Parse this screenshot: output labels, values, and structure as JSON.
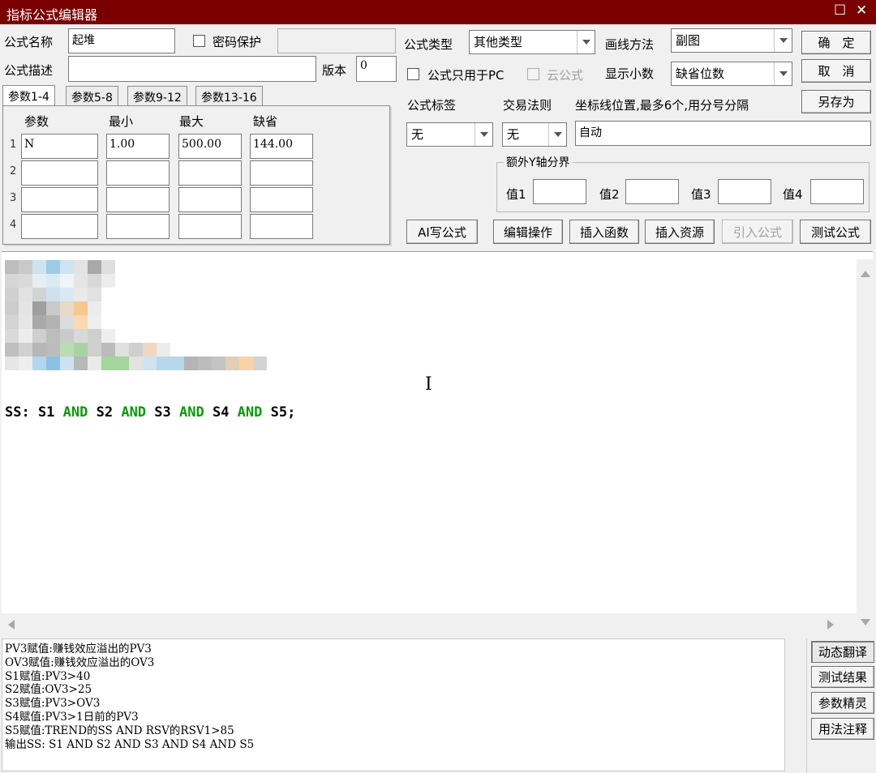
{
  "window": {
    "title": "指标公式编辑器",
    "maximize_glyph": "☐",
    "close_glyph": "✕"
  },
  "form": {
    "name_label": "公式名称",
    "name_value": "起堆",
    "password_label": "密码保护",
    "password_value": "",
    "desc_label": "公式描述",
    "desc_value": "",
    "version_label": "版本",
    "version_value": "0",
    "type_label": "公式类型",
    "type_value": "其他类型",
    "draw_label": "画线方法",
    "draw_value": "副图",
    "pc_only_label": "公式只用于PC",
    "cloud_label": "云公式",
    "decimal_label": "显示小数",
    "decimal_value": "缺省位数",
    "tag_label": "公式标签",
    "tag_value": "无",
    "trade_label": "交易法则",
    "trade_value": "无",
    "axis_label": "坐标线位置,最多6个,用分号分隔",
    "axis_value": "自动",
    "yaxis_group": "额外Y轴分界",
    "yaxis_fields": [
      {
        "label": "值1",
        "value": ""
      },
      {
        "label": "值2",
        "value": ""
      },
      {
        "label": "值3",
        "value": ""
      },
      {
        "label": "值4",
        "value": ""
      }
    ]
  },
  "buttons": {
    "ok": "确　定",
    "cancel": "取　消",
    "save_as": "另存为",
    "ai": "AI写公式",
    "edit": "编辑操作",
    "insert_func": "插入函数",
    "insert_res": "插入资源",
    "import": "引入公式",
    "test": "测试公式"
  },
  "params": {
    "tabs": [
      "参数1-4",
      "参数5-8",
      "参数9-12",
      "参数13-16"
    ],
    "headers": [
      "参数",
      "最小",
      "最大",
      "缺省"
    ],
    "rows": [
      {
        "num": "1",
        "name": "N",
        "min": "1.00",
        "max": "500.00",
        "def": "144.00"
      },
      {
        "num": "2",
        "name": "",
        "min": "",
        "max": "",
        "def": ""
      },
      {
        "num": "3",
        "name": "",
        "min": "",
        "max": "",
        "def": ""
      },
      {
        "num": "4",
        "name": "",
        "min": "",
        "max": "",
        "def": ""
      }
    ]
  },
  "editor": {
    "tokens": [
      "SS: S1 ",
      "AND",
      " S2 ",
      "AND",
      " S3 ",
      "AND",
      " S4 ",
      "AND",
      " S5;"
    ],
    "keyword_color": "#0a9a0a"
  },
  "output": {
    "lines": [
      "PV3赋值:赚钱效应溢出的PV3",
      "OV3赋值:赚钱效应溢出的OV3",
      "S1赋值:PV3>40",
      "S2赋值:OV3>25",
      "S3赋值:PV3>OV3",
      "S4赋值:PV3>1日前的PV3",
      "S5赋值:TREND的SS AND RSV的RSV1>85",
      "输出SS: S1 AND S2 AND S3 AND S4 AND S5"
    ]
  },
  "side_buttons": [
    "动态翻译",
    "测试结果",
    "参数精灵",
    "用法注释"
  ],
  "colors": {
    "titlebar": "#7a0000",
    "background": "#f0f0f0"
  }
}
